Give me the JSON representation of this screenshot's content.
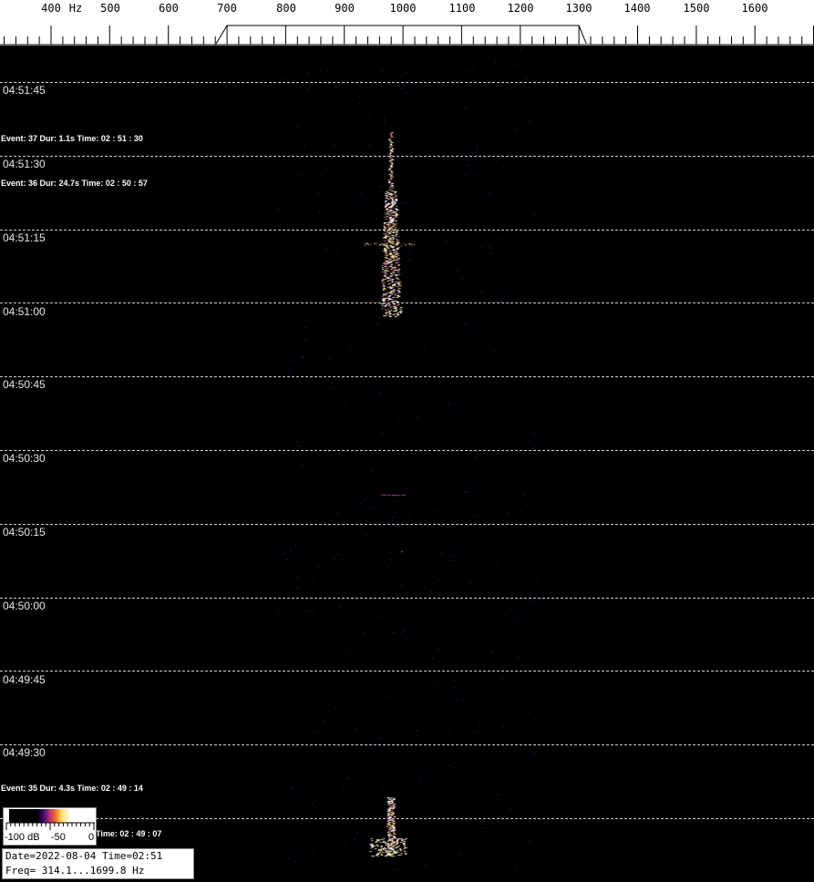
{
  "frequency_scale": {
    "unit": "Hz",
    "ticks": [
      "400",
      "500",
      "600",
      "700",
      "800",
      "900",
      "1000",
      "1100",
      "1200",
      "1300",
      "1400",
      "1500",
      "1600"
    ]
  },
  "time_labels": [
    "04:51:45",
    "04:51:30",
    "04:51:15",
    "04:51:00",
    "04:50:45",
    "04:50:30",
    "04:50:15",
    "04:50:00",
    "04:49:45",
    "04:49:30"
  ],
  "events": [
    {
      "text": "Event: 37  Dur:  1.1s  Time:  02 : 51 : 30"
    },
    {
      "text": "Event: 36  Dur:  24.7s  Time:  02 : 50 : 57"
    },
    {
      "text": "Event: 35  Dur:  4.3s  Time:  02 : 49 : 14"
    },
    {
      "text": "Time:  02 : 49 : 07"
    }
  ],
  "legend": {
    "min_label": "-100 dB",
    "mid_label": "-50",
    "max_label": "0"
  },
  "info": {
    "line1": "Date=2022-08-04 Time=02:51",
    "line2": "Freq= 314.1...1699.8 Hz"
  },
  "colors": {
    "background": "#000000",
    "signal_hot": "#ffffff",
    "signal_warm": "#ffd070",
    "signal_cool": "#7a2a9a"
  }
}
